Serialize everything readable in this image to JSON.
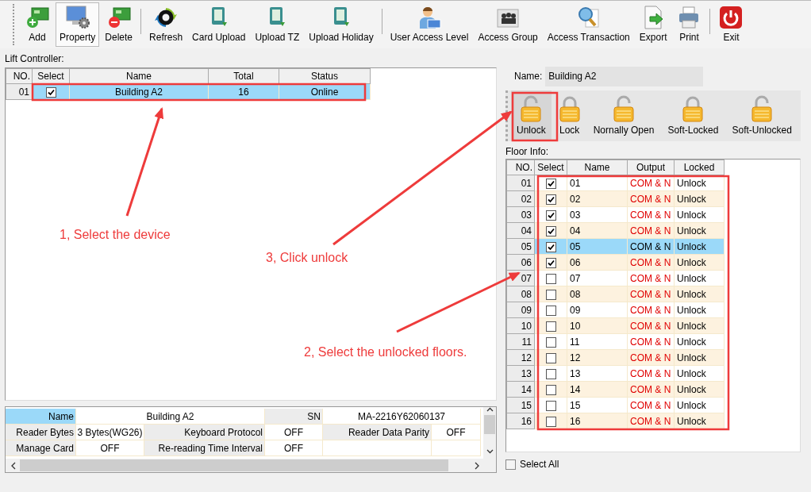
{
  "toolbar": {
    "buttons": [
      {
        "label": "Add",
        "selected": false
      },
      {
        "label": "Property",
        "selected": true
      },
      {
        "label": "Delete",
        "selected": false
      },
      {
        "label": "Refresh",
        "selected": false
      },
      {
        "label": "Card Upload",
        "selected": false
      },
      {
        "label": "Upload TZ",
        "selected": false
      },
      {
        "label": "Upload Holiday",
        "selected": false
      },
      {
        "label": "User Access Level",
        "selected": false
      },
      {
        "label": "Access Group",
        "selected": false
      },
      {
        "label": "Access Transaction",
        "selected": false
      },
      {
        "label": "Export",
        "selected": false
      },
      {
        "label": "Print",
        "selected": false
      },
      {
        "label": "Exit",
        "selected": false
      }
    ]
  },
  "lift_controller": {
    "label": "Lift Controller:",
    "columns": [
      "NO.",
      "Select",
      "Name",
      "Total",
      "Status"
    ],
    "rows": [
      {
        "no": "01",
        "checked": true,
        "name": "Building A2",
        "total": "16",
        "status": "Online",
        "selected": true
      }
    ]
  },
  "properties": {
    "rows": [
      [
        {
          "kind": "label",
          "text": "Name",
          "selected": true
        },
        {
          "kind": "value",
          "text": "Building A2"
        },
        {
          "kind": "continued"
        },
        {
          "kind": "label",
          "text": "SN",
          "selected": false
        },
        {
          "kind": "value",
          "text": "MA-2216Y62060137"
        },
        {
          "kind": "continued"
        }
      ],
      [
        {
          "kind": "label",
          "text": "Reader Bytes",
          "selected": false
        },
        {
          "kind": "value",
          "text": "3 Bytes(WG26)"
        },
        {
          "kind": "label",
          "text": "Keyboard Protocol",
          "selected": false
        },
        {
          "kind": "value",
          "text": "OFF"
        },
        {
          "kind": "label",
          "text": "Reader Data Parity",
          "selected": false
        },
        {
          "kind": "value",
          "text": "OFF"
        }
      ],
      [
        {
          "kind": "label",
          "text": "Manage Card",
          "selected": false
        },
        {
          "kind": "value",
          "text": "OFF"
        },
        {
          "kind": "label",
          "text": "Re-reading Time Interval",
          "selected": false
        },
        {
          "kind": "value",
          "text": "OFF"
        },
        {
          "kind": "value"
        },
        {
          "kind": "value"
        }
      ]
    ]
  },
  "device": {
    "name_label": "Name:",
    "name_value": "Building A2"
  },
  "lock_actions": [
    {
      "label": "Unlock",
      "kind": "open",
      "selected": true
    },
    {
      "label": "Lock",
      "kind": "closed",
      "selected": false
    },
    {
      "label": "Nornally Open",
      "kind": "open",
      "selected": false
    },
    {
      "label": "Soft-Locked",
      "kind": "closed",
      "selected": false
    },
    {
      "label": "Soft-Unlocked",
      "kind": "open",
      "selected": false
    }
  ],
  "floor_info": {
    "label": "Floor Info:",
    "columns": [
      "NO.",
      "Select",
      "Name",
      "Output",
      "Locked"
    ],
    "rows": [
      {
        "no": "01",
        "checked": true,
        "name": "01",
        "output": "COM & N",
        "locked": "Unlock",
        "selected": false
      },
      {
        "no": "02",
        "checked": true,
        "name": "02",
        "output": "COM & N",
        "locked": "Unlock",
        "selected": false
      },
      {
        "no": "03",
        "checked": true,
        "name": "03",
        "output": "COM & N",
        "locked": "Unlock",
        "selected": false
      },
      {
        "no": "04",
        "checked": true,
        "name": "04",
        "output": "COM & N",
        "locked": "Unlock",
        "selected": false
      },
      {
        "no": "05",
        "checked": true,
        "name": "05",
        "output": "COM & N",
        "locked": "Unlock",
        "selected": true
      },
      {
        "no": "06",
        "checked": true,
        "name": "06",
        "output": "COM & N",
        "locked": "Unlock",
        "selected": false
      },
      {
        "no": "07",
        "checked": false,
        "name": "07",
        "output": "COM & N",
        "locked": "Unlock",
        "selected": false
      },
      {
        "no": "08",
        "checked": false,
        "name": "08",
        "output": "COM & N",
        "locked": "Unlock",
        "selected": false
      },
      {
        "no": "09",
        "checked": false,
        "name": "09",
        "output": "COM & N",
        "locked": "Unlock",
        "selected": false
      },
      {
        "no": "10",
        "checked": false,
        "name": "10",
        "output": "COM & N",
        "locked": "Unlock",
        "selected": false
      },
      {
        "no": "11",
        "checked": false,
        "name": "11",
        "output": "COM & N",
        "locked": "Unlock",
        "selected": false
      },
      {
        "no": "12",
        "checked": false,
        "name": "12",
        "output": "COM & N",
        "locked": "Unlock",
        "selected": false
      },
      {
        "no": "13",
        "checked": false,
        "name": "13",
        "output": "COM & N",
        "locked": "Unlock",
        "selected": false
      },
      {
        "no": "14",
        "checked": false,
        "name": "14",
        "output": "COM & N",
        "locked": "Unlock",
        "selected": false
      },
      {
        "no": "15",
        "checked": false,
        "name": "15",
        "output": "COM & N",
        "locked": "Unlock",
        "selected": false
      },
      {
        "no": "16",
        "checked": false,
        "name": "16",
        "output": "COM & N",
        "locked": "Unlock",
        "selected": false
      }
    ],
    "select_all": {
      "label": "Select All",
      "checked": false
    }
  },
  "annotations": [
    {
      "text": "1, Select the device"
    },
    {
      "text": "3, Click unlock"
    },
    {
      "text": "2, Select the unlocked floors."
    }
  ]
}
